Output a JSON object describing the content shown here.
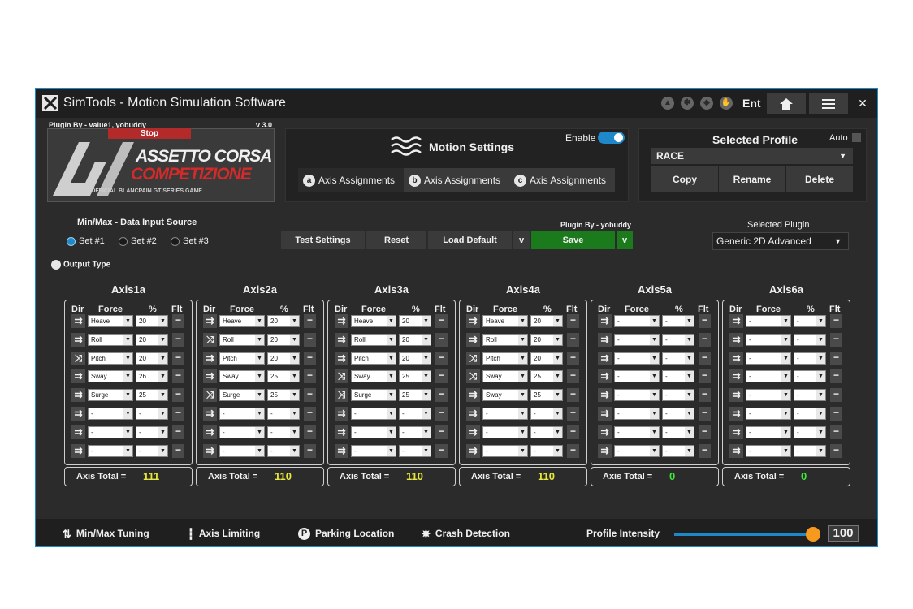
{
  "window": {
    "title": "SimTools - Motion Simulation Software",
    "ent_label": "Ent"
  },
  "plugin_banner": {
    "plugin_by": "Plugin By - value1, yobuddy",
    "version": "v 3.0",
    "stop_label": "Stop",
    "game_title_line1": "ASSETTO CORSA",
    "game_title_line2": "COMPETIZIONE",
    "game_subtitle": "THE OFFICIAL BLANCPAIN GT SERIES GAME"
  },
  "motion_settings": {
    "title": "Motion Settings",
    "enable_label": "Enable",
    "enabled": true,
    "tabs": [
      {
        "letter": "a",
        "label": "Axis Assignments"
      },
      {
        "letter": "b",
        "label": "Axis Assignments"
      },
      {
        "letter": "c",
        "label": "Axis Assignments"
      }
    ]
  },
  "selected_profile": {
    "title": "Selected Profile",
    "auto_label": "Auto",
    "value": "RACE",
    "buttons": [
      "Copy",
      "Rename",
      "Delete"
    ]
  },
  "data_input": {
    "title": "Min/Max - Data Input Source",
    "options": [
      "Set #1",
      "Set #2",
      "Set #3"
    ],
    "selected": "Set #1"
  },
  "output_type_label": "Output Type",
  "actions": {
    "plugin_by": "Plugin By - yobuddy",
    "test_settings": "Test Settings",
    "reset": "Reset",
    "load_default": "Load Default",
    "save": "Save",
    "caret": "v"
  },
  "selected_plugin": {
    "title": "Selected Plugin",
    "value": "Generic 2D Advanced"
  },
  "axis_headers": {
    "dir": "Dir",
    "force": "Force",
    "pct": "%",
    "flt": "Flt"
  },
  "axis_total_label": "Axis Total =",
  "axes": [
    {
      "name": "Axis1a",
      "total": "111",
      "total_color": "#e8e83a",
      "rows": [
        {
          "dir": "same",
          "force": "Heave",
          "pct": "20"
        },
        {
          "dir": "same",
          "force": "Roll",
          "pct": "20"
        },
        {
          "dir": "cross",
          "force": "Pitch",
          "pct": "20"
        },
        {
          "dir": "same",
          "force": "Sway",
          "pct": "26"
        },
        {
          "dir": "same",
          "force": "Surge",
          "pct": "25"
        },
        {
          "dir": "same",
          "force": "-",
          "pct": "-"
        },
        {
          "dir": "same",
          "force": "-",
          "pct": "-"
        },
        {
          "dir": "same",
          "force": "-",
          "pct": "-"
        }
      ]
    },
    {
      "name": "Axis2a",
      "total": "110",
      "total_color": "#e8e83a",
      "rows": [
        {
          "dir": "same",
          "force": "Heave",
          "pct": "20"
        },
        {
          "dir": "cross",
          "force": "Roll",
          "pct": "20"
        },
        {
          "dir": "same",
          "force": "Pitch",
          "pct": "20"
        },
        {
          "dir": "same",
          "force": "Sway",
          "pct": "25"
        },
        {
          "dir": "cross",
          "force": "Surge",
          "pct": "25"
        },
        {
          "dir": "same",
          "force": "-",
          "pct": "-"
        },
        {
          "dir": "same",
          "force": "-",
          "pct": "-"
        },
        {
          "dir": "same",
          "force": "-",
          "pct": "-"
        }
      ]
    },
    {
      "name": "Axis3a",
      "total": "110",
      "total_color": "#e8e83a",
      "rows": [
        {
          "dir": "same",
          "force": "Heave",
          "pct": "20"
        },
        {
          "dir": "same",
          "force": "Roll",
          "pct": "20"
        },
        {
          "dir": "same",
          "force": "Pitch",
          "pct": "20"
        },
        {
          "dir": "cross",
          "force": "Sway",
          "pct": "25"
        },
        {
          "dir": "cross",
          "force": "Surge",
          "pct": "25"
        },
        {
          "dir": "same",
          "force": "-",
          "pct": "-"
        },
        {
          "dir": "same",
          "force": "-",
          "pct": "-"
        },
        {
          "dir": "same",
          "force": "-",
          "pct": "-"
        }
      ]
    },
    {
      "name": "Axis4a",
      "total": "110",
      "total_color": "#e8e83a",
      "rows": [
        {
          "dir": "same",
          "force": "Heave",
          "pct": "20"
        },
        {
          "dir": "same",
          "force": "Roll",
          "pct": "20"
        },
        {
          "dir": "cross",
          "force": "Pitch",
          "pct": "20"
        },
        {
          "dir": "cross",
          "force": "Sway",
          "pct": "25"
        },
        {
          "dir": "same",
          "force": "Sway",
          "pct": "25"
        },
        {
          "dir": "same",
          "force": "-",
          "pct": "-"
        },
        {
          "dir": "same",
          "force": "-",
          "pct": "-"
        },
        {
          "dir": "same",
          "force": "-",
          "pct": "-"
        }
      ]
    },
    {
      "name": "Axis5a",
      "total": "0",
      "total_color": "#3ee83a",
      "rows": [
        {
          "dir": "same",
          "force": "-",
          "pct": "-"
        },
        {
          "dir": "same",
          "force": "-",
          "pct": "-"
        },
        {
          "dir": "same",
          "force": "-",
          "pct": "-"
        },
        {
          "dir": "same",
          "force": "-",
          "pct": "-"
        },
        {
          "dir": "same",
          "force": "-",
          "pct": "-"
        },
        {
          "dir": "same",
          "force": "-",
          "pct": "-"
        },
        {
          "dir": "same",
          "force": "-",
          "pct": "-"
        },
        {
          "dir": "same",
          "force": "-",
          "pct": "-"
        }
      ]
    },
    {
      "name": "Axis6a",
      "total": "0",
      "total_color": "#3ee83a",
      "rows": [
        {
          "dir": "same",
          "force": "-",
          "pct": "-"
        },
        {
          "dir": "same",
          "force": "-",
          "pct": "-"
        },
        {
          "dir": "same",
          "force": "-",
          "pct": "-"
        },
        {
          "dir": "same",
          "force": "-",
          "pct": "-"
        },
        {
          "dir": "same",
          "force": "-",
          "pct": "-"
        },
        {
          "dir": "same",
          "force": "-",
          "pct": "-"
        },
        {
          "dir": "same",
          "force": "-",
          "pct": "-"
        },
        {
          "dir": "same",
          "force": "-",
          "pct": "-"
        }
      ]
    }
  ],
  "bottom_bar": {
    "items": [
      "Min/Max Tuning",
      "Axis Limiting",
      "Parking Location",
      "Crash Detection"
    ],
    "profile_intensity_label": "Profile Intensity",
    "profile_intensity_value": "100"
  },
  "icons": {
    "dir_same": "double-arrow-right-icon",
    "dir_cross": "crossed-arrows-icon",
    "flt": "minus-icon"
  },
  "colors": {
    "accent": "#1e88c8",
    "save": "#1b7a1b",
    "stop": "#b22a2a",
    "total_nonzero": "#e8e83a",
    "total_zero": "#3ee83a",
    "slider_knob": "#f59a1e"
  }
}
